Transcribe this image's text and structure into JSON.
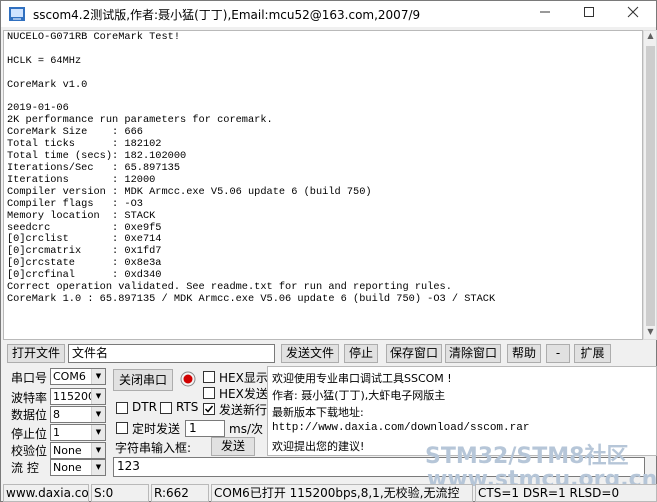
{
  "window": {
    "title": "sscom4.2测试版,作者:聂小猛(丁丁),Email:mcu52@163.com,2007/9"
  },
  "console": {
    "lines": [
      "NUCELO-G071RB CoreMark Test!",
      "",
      "HCLK = 64MHz",
      "",
      "CoreMark v1.0",
      "",
      "2019-01-06",
      "2K performance run parameters for coremark.",
      "CoreMark Size    : 666",
      "Total ticks      : 182102",
      "Total time (secs): 182.102000",
      "Iterations/Sec   : 65.897135",
      "Iterations       : 12000",
      "Compiler version : MDK Armcc.exe V5.06 update 6 (build 750)",
      "Compiler flags   : -O3",
      "Memory location  : STACK",
      "seedcrc          : 0xe9f5",
      "[0]crclist       : 0xe714",
      "[0]crcmatrix     : 0x1fd7",
      "[0]crcstate      : 0x8e3a",
      "[0]crcfinal      : 0xd340",
      "Correct operation validated. See readme.txt for run and reporting rules.",
      "CoreMark 1.0 : 65.897135 / MDK Armcc.exe V5.06 update 6 (build 750) -O3 / STACK"
    ]
  },
  "filebar": {
    "open_file": "打开文件",
    "filename": "文件名",
    "send_file": "发送文件",
    "stop": "停止",
    "save_window": "保存窗口",
    "clear_window": "清除窗口",
    "help": "帮助",
    "minus": "-",
    "expand": "扩展"
  },
  "serial": {
    "port_label": "串口号",
    "port_value": "COM6",
    "baud_label": "波特率",
    "baud_value": "115200",
    "data_label": "数据位",
    "data_value": "8",
    "stop_label": "停止位",
    "stop_value": "1",
    "parity_label": "校验位",
    "parity_value": "None",
    "flow_label": "流 控",
    "flow_value": "None"
  },
  "controls": {
    "close_port": "关闭串口",
    "hex_display": "HEX显示",
    "hex_send": "HEX发送",
    "dtr": "DTR",
    "rts": "RTS",
    "send_newline": "发送新行",
    "timed_send": "定时发送",
    "interval_value": "1",
    "interval_unit": "ms/次",
    "string_input_label": "字符串输入框:",
    "send": "发送",
    "input_value": "123",
    "send_newline_checked": true,
    "port_open": true
  },
  "info": {
    "line1": "欢迎使用专业串口调试工具SSCOM !",
    "line2": "作者: 聂小猛(丁丁),大虾电子网版主",
    "line3": "最新版本下载地址:",
    "line4": "http://www.daxia.com/download/sscom.rar",
    "line5": "欢迎提出您的建议!"
  },
  "status": {
    "site": "www.daxia.cor",
    "sent": "S:0",
    "received": "R:662",
    "port_state": "COM6已打开  115200bps,8,1,无校验,无流控",
    "signals": "CTS=1 DSR=1 RLSD=0"
  },
  "watermark": {
    "line1": "STM32/STM8社区",
    "line2": "www.stmcu.org.cn"
  },
  "colors": {
    "indicator": "#d00000",
    "watermark": "#b6c6d8"
  }
}
